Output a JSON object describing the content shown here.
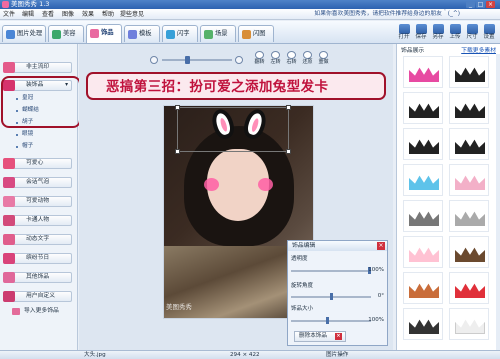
{
  "title_bar": {
    "title": "美图秀秀 1.3",
    "minimize": "_",
    "maximize": "□",
    "close": "×"
  },
  "menu": {
    "items": [
      "文件",
      "编辑",
      "查看",
      "图像",
      "效果",
      "帮助",
      "提些意见"
    ],
    "slogan": "如果你喜欢美图秀秀，请把软件推荐给身边的朋友＾(_^)"
  },
  "tabs": [
    {
      "label": "图片处理",
      "icon": "image-icon",
      "color": "#4a86d6"
    },
    {
      "label": "美容",
      "icon": "face-icon",
      "color": "#3ca86b"
    },
    {
      "label": "饰品",
      "icon": "ornament-icon",
      "color": "#e96aa0",
      "active": true
    },
    {
      "label": "模板",
      "icon": "template-icon",
      "color": "#6f7fdc"
    },
    {
      "label": "闪字",
      "icon": "flash-text-icon",
      "color": "#37a0d8"
    },
    {
      "label": "场景",
      "icon": "scene-icon",
      "color": "#56b26a"
    },
    {
      "label": "闪图",
      "icon": "flash-image-icon",
      "color": "#d88e37"
    }
  ],
  "toolbar": [
    "打开",
    "保存",
    "另存",
    "上传",
    "尺寸",
    "设置"
  ],
  "left_panel": {
    "categories": [
      {
        "label": "非主流印",
        "icon": "stamp-icon",
        "color": "#e45a8a"
      },
      {
        "label": "装饰品",
        "icon": "bow-icon",
        "color": "#d6336c",
        "expanded": true
      },
      {
        "label": "可爱心",
        "icon": "heart-icon",
        "color": "#e6507c"
      },
      {
        "label": "会话气泡",
        "icon": "speech-bubble-icon",
        "color": "#d84a82"
      },
      {
        "label": "可爱动物",
        "icon": "animal-icon",
        "color": "#e87aa6"
      },
      {
        "label": "卡通人物",
        "icon": "cartoon-icon",
        "color": "#d24a7a"
      },
      {
        "label": "动态文字",
        "icon": "text-icon",
        "color": "#e05d8c"
      },
      {
        "label": "缤纷节日",
        "icon": "festival-icon",
        "color": "#d9437a"
      },
      {
        "label": "其他饰品",
        "icon": "misc-icon",
        "color": "#e0689a"
      },
      {
        "label": "用户自定义",
        "icon": "user-icon",
        "color": "#cc3c70"
      }
    ],
    "subitems": [
      "皇冠",
      "蝴蝶结",
      "胡子",
      "眼镜",
      "帽子"
    ],
    "import_button": "导入更多饰品"
  },
  "canvas_tools": [
    "翻转",
    "左转",
    "右转",
    "还原",
    "重做"
  ],
  "banner": {
    "text": "恶搞第三招：扮可爱之添加兔型发卡"
  },
  "photo": {
    "watermark": "美图秀秀"
  },
  "edit_panel": {
    "title": "饰品编辑",
    "close": "×",
    "transparency_label": "透明度",
    "transparency_value": "100%",
    "rotation_label": "旋转角度",
    "rotation_value": "0°",
    "size_label": "饰品大小",
    "size_value": "100%",
    "delete_button": "删除本饰品",
    "transparency_level": 1.0,
    "rotation_level": 0.5,
    "size_level": 0.45
  },
  "right_panel": {
    "header": "饰品展示",
    "link": "下载更多素材"
  },
  "status_bar": {
    "file": "大头.jpg",
    "size": "294 × 422",
    "mode": "图片操作"
  }
}
